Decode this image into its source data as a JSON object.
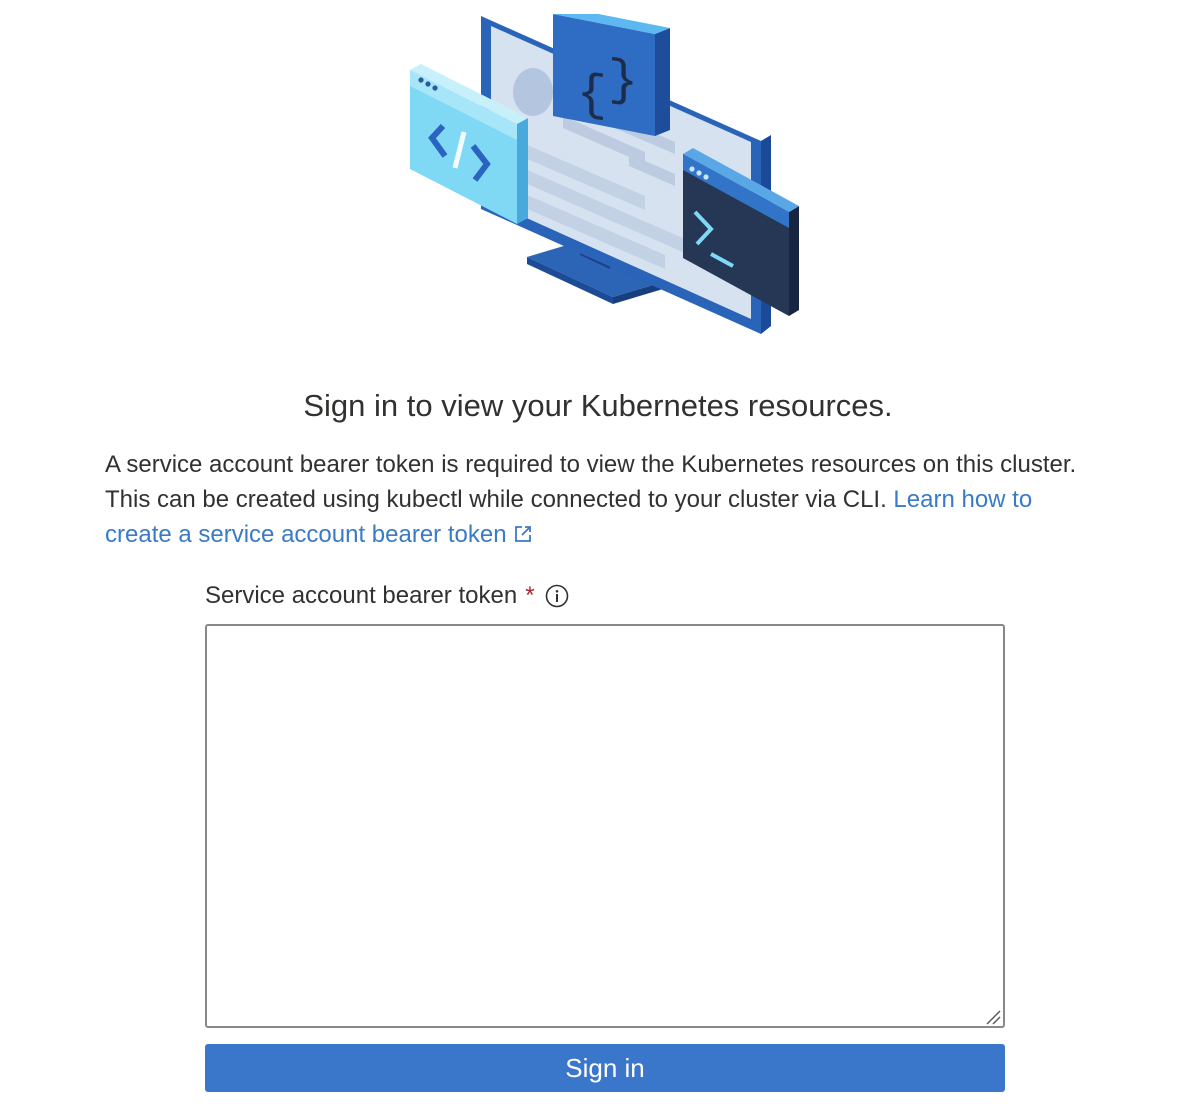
{
  "hero": {
    "icon": "kubernetes-devices-illustration"
  },
  "heading": "Sign in to view your Kubernetes resources.",
  "description": {
    "text": "A service account bearer token is required to view the Kubernetes resources on this cluster. This can be created using kubectl while connected to your cluster via CLI. ",
    "link_text": "Learn how to create a service account bearer token"
  },
  "form": {
    "label": "Service account bearer token",
    "required_mark": "*",
    "token_value": "",
    "submit_label": "Sign in"
  },
  "colors": {
    "link": "#3a7ac6",
    "button": "#3a77cb",
    "required": "#a4262c"
  }
}
